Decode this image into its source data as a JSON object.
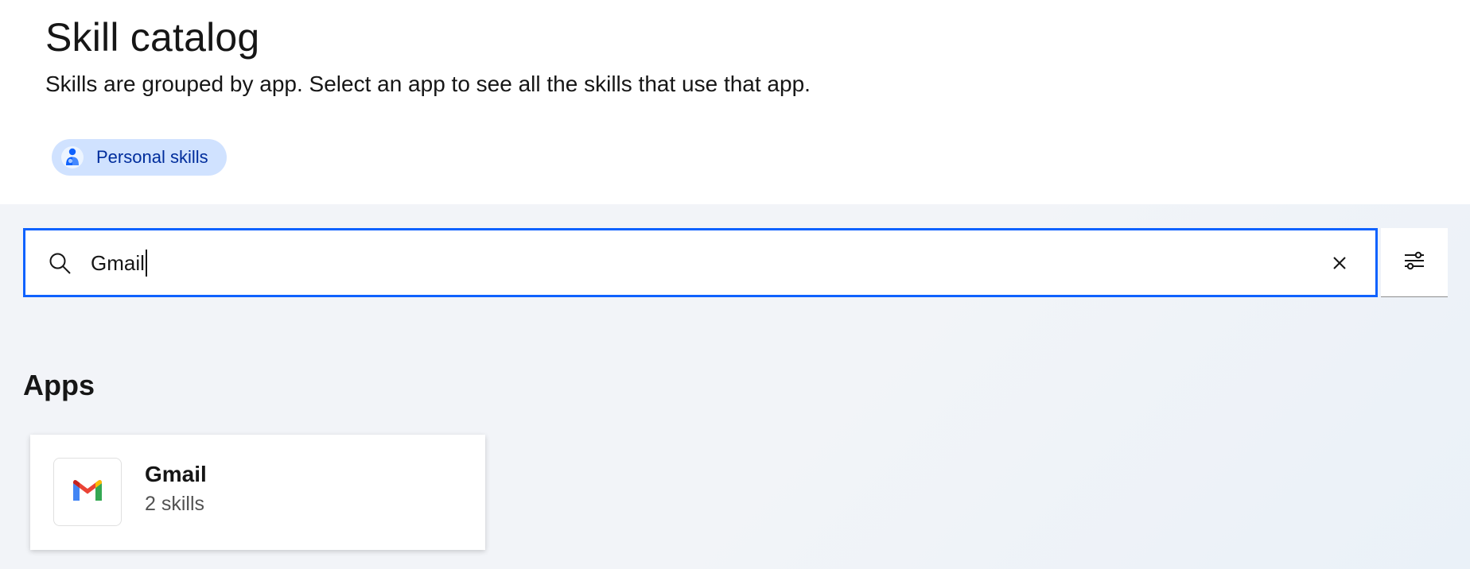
{
  "header": {
    "title": "Skill catalog",
    "subtitle": "Skills are grouped by app. Select an app to see all the skills that use that app.",
    "tag": {
      "label": "Personal skills",
      "icon": "person-icon"
    }
  },
  "search": {
    "value": "Gmail",
    "icon": "search-icon",
    "clear_icon": "close-icon",
    "filter_icon": "sliders-icon"
  },
  "apps_section": {
    "title": "Apps",
    "items": [
      {
        "name": "Gmail",
        "count": "2 skills",
        "icon": "gmail-logo-icon"
      }
    ]
  },
  "colors": {
    "accent": "#0f62fe",
    "tag_bg": "#d0e2ff",
    "tag_text": "#002d9c",
    "content_bg": "#f2f4f8"
  }
}
